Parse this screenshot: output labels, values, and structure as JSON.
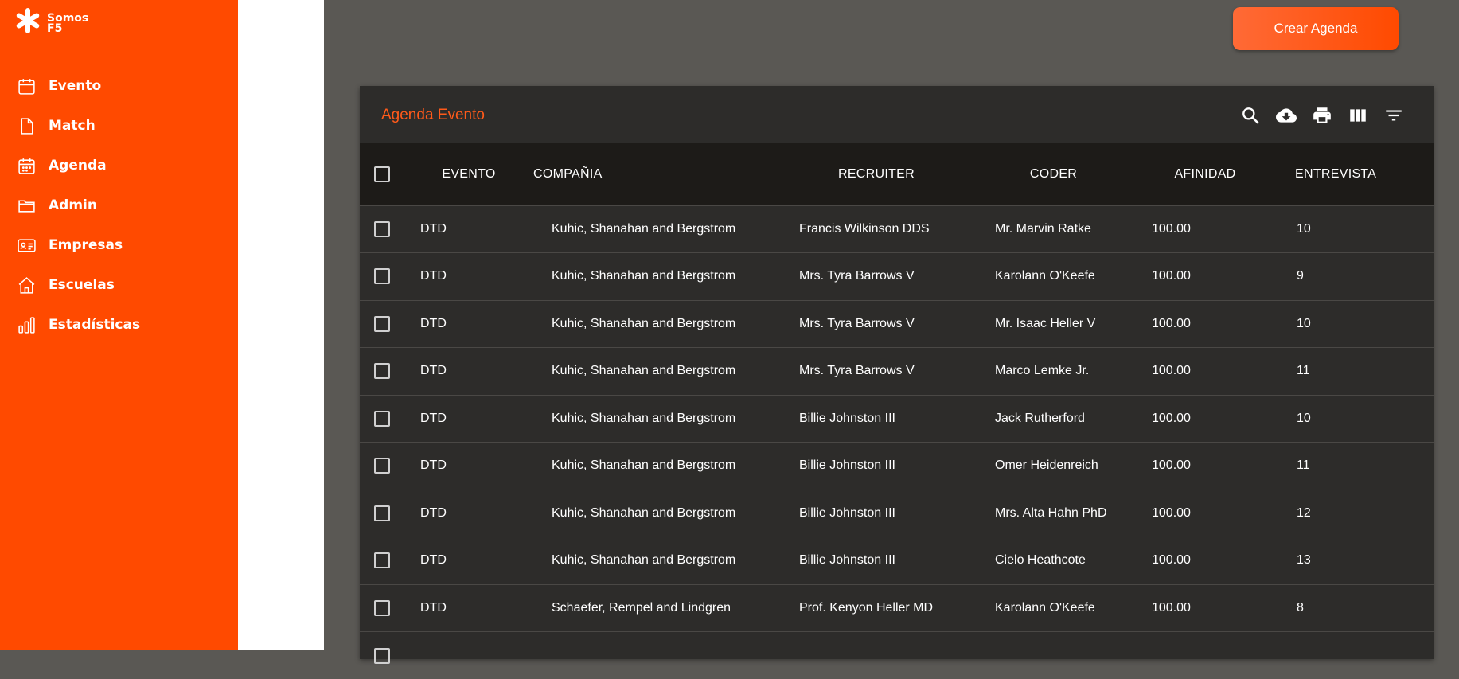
{
  "brand": {
    "line1": "Somos",
    "line2": "F5"
  },
  "sidebar": {
    "items": [
      {
        "label": "Evento",
        "icon": "calendar-icon"
      },
      {
        "label": "Match",
        "icon": "file-icon"
      },
      {
        "label": "Agenda",
        "icon": "calendar-grid-icon"
      },
      {
        "label": "Admin",
        "icon": "folder-icon"
      },
      {
        "label": "Empresas",
        "icon": "id-card-icon"
      },
      {
        "label": "Escuelas",
        "icon": "home-icon"
      },
      {
        "label": "Estadísticas",
        "icon": "bar-chart-icon"
      }
    ]
  },
  "header": {
    "create_button": "Crear Agenda"
  },
  "panel": {
    "title": "Agenda Evento"
  },
  "toolbar": {
    "icons": [
      "search-icon",
      "cloud-download-icon",
      "print-icon",
      "columns-icon",
      "filter-icon"
    ]
  },
  "table": {
    "columns": [
      "EVENTO",
      "COMPAÑIA",
      "RECRUITER",
      "CODER",
      "AFINIDAD",
      "ENTREVISTA"
    ],
    "rows": [
      [
        "DTD",
        "Kuhic, Shanahan and Bergstrom",
        "Francis Wilkinson DDS",
        "Mr. Marvin Ratke",
        "100.00",
        "10"
      ],
      [
        "DTD",
        "Kuhic, Shanahan and Bergstrom",
        "Mrs. Tyra Barrows V",
        "Karolann O'Keefe",
        "100.00",
        "9"
      ],
      [
        "DTD",
        "Kuhic, Shanahan and Bergstrom",
        "Mrs. Tyra Barrows V",
        "Mr. Isaac Heller V",
        "100.00",
        "10"
      ],
      [
        "DTD",
        "Kuhic, Shanahan and Bergstrom",
        "Mrs. Tyra Barrows V",
        "Marco Lemke Jr.",
        "100.00",
        "11"
      ],
      [
        "DTD",
        "Kuhic, Shanahan and Bergstrom",
        "Billie Johnston III",
        "Jack Rutherford",
        "100.00",
        "10"
      ],
      [
        "DTD",
        "Kuhic, Shanahan and Bergstrom",
        "Billie Johnston III",
        "Omer Heidenreich",
        "100.00",
        "11"
      ],
      [
        "DTD",
        "Kuhic, Shanahan and Bergstrom",
        "Billie Johnston III",
        "Mrs. Alta Hahn PhD",
        "100.00",
        "12"
      ],
      [
        "DTD",
        "Kuhic, Shanahan and Bergstrom",
        "Billie Johnston III",
        "Cielo Heathcote",
        "100.00",
        "13"
      ],
      [
        "DTD",
        "Schaefer, Rempel and Lindgren",
        "Prof. Kenyon Heller MD",
        "Karolann O'Keefe",
        "100.00",
        "8"
      ],
      [
        "",
        "",
        "",
        "",
        "",
        ""
      ]
    ]
  },
  "colors": {
    "brand": "#ff4a00",
    "panel": "#2d2c2a",
    "header_row": "#1d1b18",
    "title": "#ff5a1a"
  }
}
